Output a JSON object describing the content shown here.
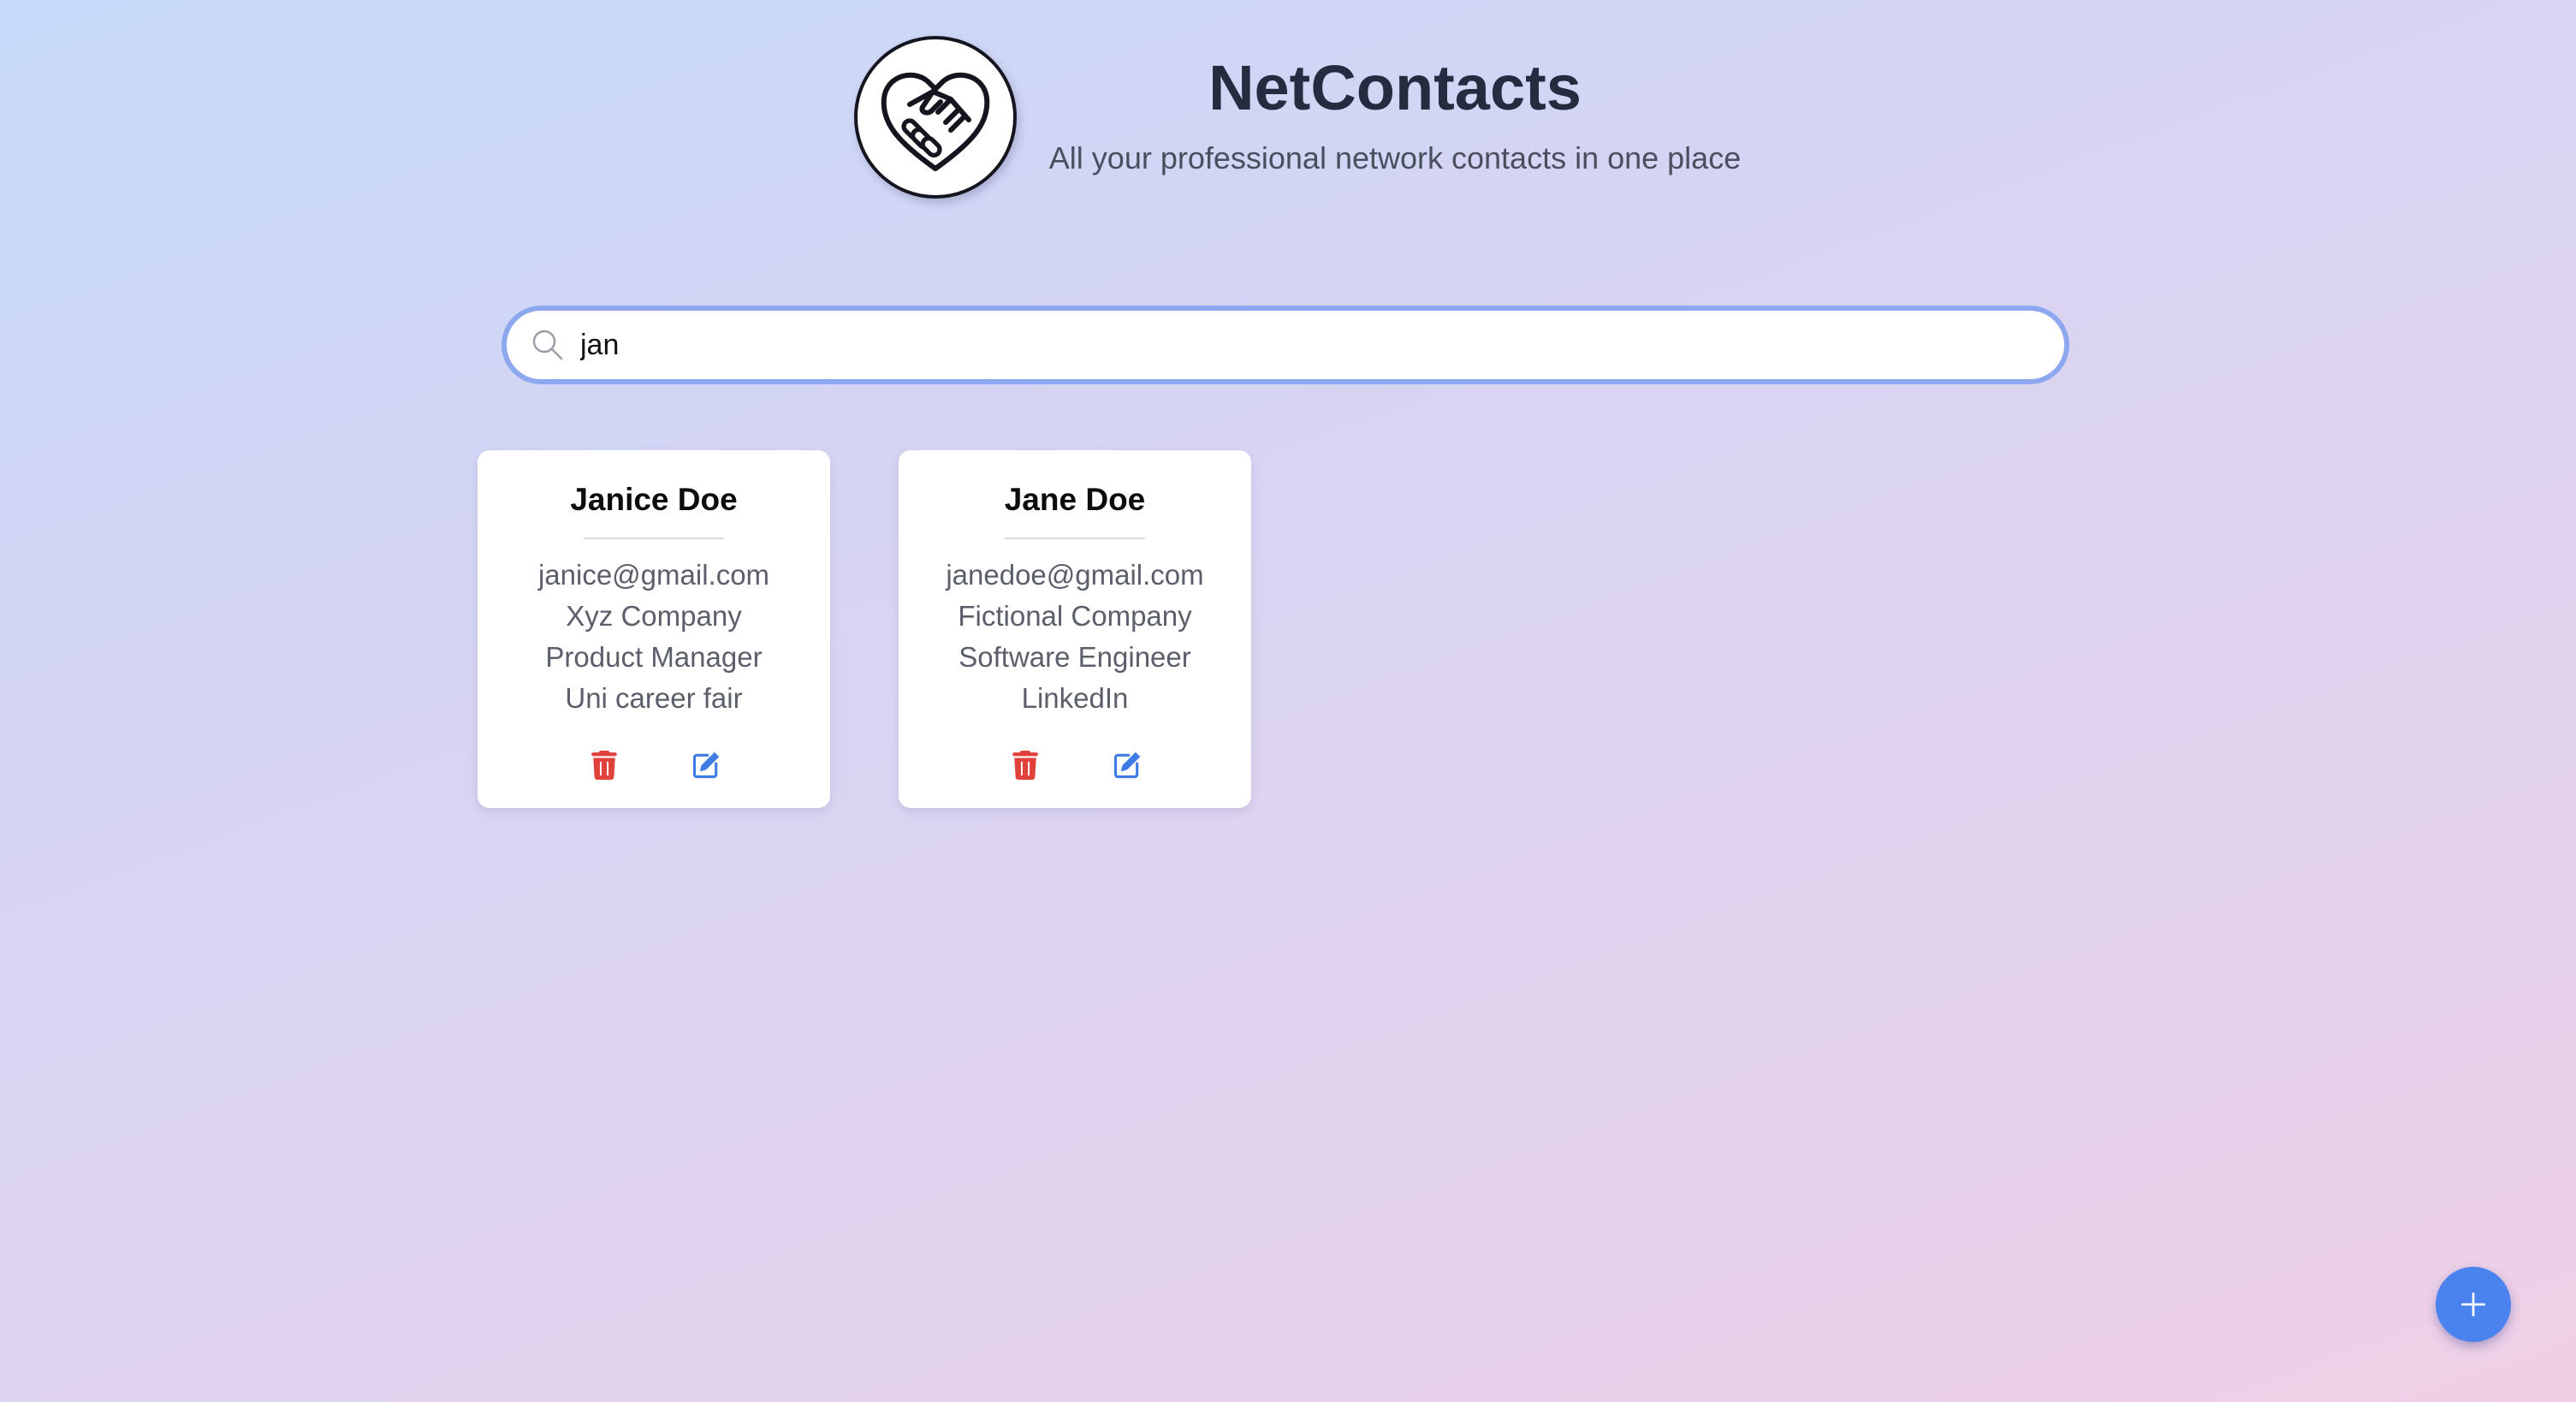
{
  "header": {
    "title": "NetContacts",
    "subtitle": "All your professional network contacts in one place",
    "logo_icon": "handshake-heart-icon"
  },
  "search": {
    "value": "jan",
    "icon": "search-icon"
  },
  "contacts": [
    {
      "name": "Janice Doe",
      "email": "janice@gmail.com",
      "company": "Xyz Company",
      "role": "Product Manager",
      "met_at": "Uni career fair"
    },
    {
      "name": "Jane Doe",
      "email": "janedoe@gmail.com",
      "company": "Fictional Company",
      "role": "Software Engineer",
      "met_at": "LinkedIn"
    }
  ],
  "actions": {
    "delete_icon": "trash-icon",
    "edit_icon": "edit-icon",
    "add_icon": "plus-icon"
  },
  "colors": {
    "delete": "#e0413a",
    "edit": "#3f7be6",
    "fab": "#4a82ee",
    "search_border": "#8ea8ef"
  }
}
